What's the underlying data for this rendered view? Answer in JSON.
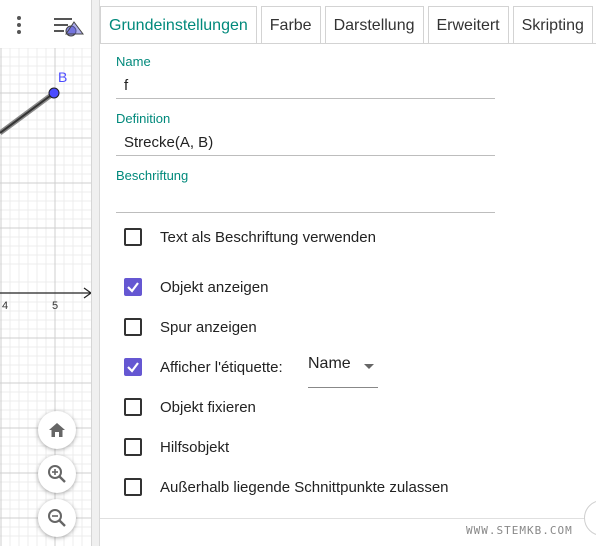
{
  "graphics": {
    "point_label": "B",
    "axis_ticks": [
      "4",
      "5"
    ]
  },
  "tabs": [
    {
      "label": "Grundeinstellungen",
      "active": true
    },
    {
      "label": "Farbe",
      "active": false
    },
    {
      "label": "Darstellung",
      "active": false
    },
    {
      "label": "Erweitert",
      "active": false
    },
    {
      "label": "Skripting",
      "active": false
    }
  ],
  "fields": {
    "name_label": "Name",
    "name_value": "f",
    "definition_label": "Definition",
    "definition_value": "Strecke(A, B)",
    "caption_label": "Beschriftung",
    "caption_value": ""
  },
  "checkboxes": [
    {
      "label": "Text als Beschriftung verwenden",
      "checked": false
    },
    {
      "label": "Objekt anzeigen",
      "checked": true
    },
    {
      "label": "Spur anzeigen",
      "checked": false
    },
    {
      "label": "Afficher l'étiquette:",
      "checked": true
    },
    {
      "label": "Objekt fixieren",
      "checked": false
    },
    {
      "label": "Hilfsobjekt",
      "checked": false
    },
    {
      "label": "Außerhalb liegende Schnittpunkte zulassen",
      "checked": false
    }
  ],
  "label_dropdown": {
    "selected": "Name"
  },
  "watermark": "WWW.STEMKB.COM",
  "colors": {
    "accent": "#00897b",
    "checkbox": "#6557d2",
    "point": "#4c4cff"
  },
  "icons": [
    "menu-dots-icon",
    "style-bar-icon",
    "home-icon",
    "zoom-in-icon",
    "zoom-out-icon",
    "checkmark-icon",
    "dropdown-arrow-icon"
  ]
}
